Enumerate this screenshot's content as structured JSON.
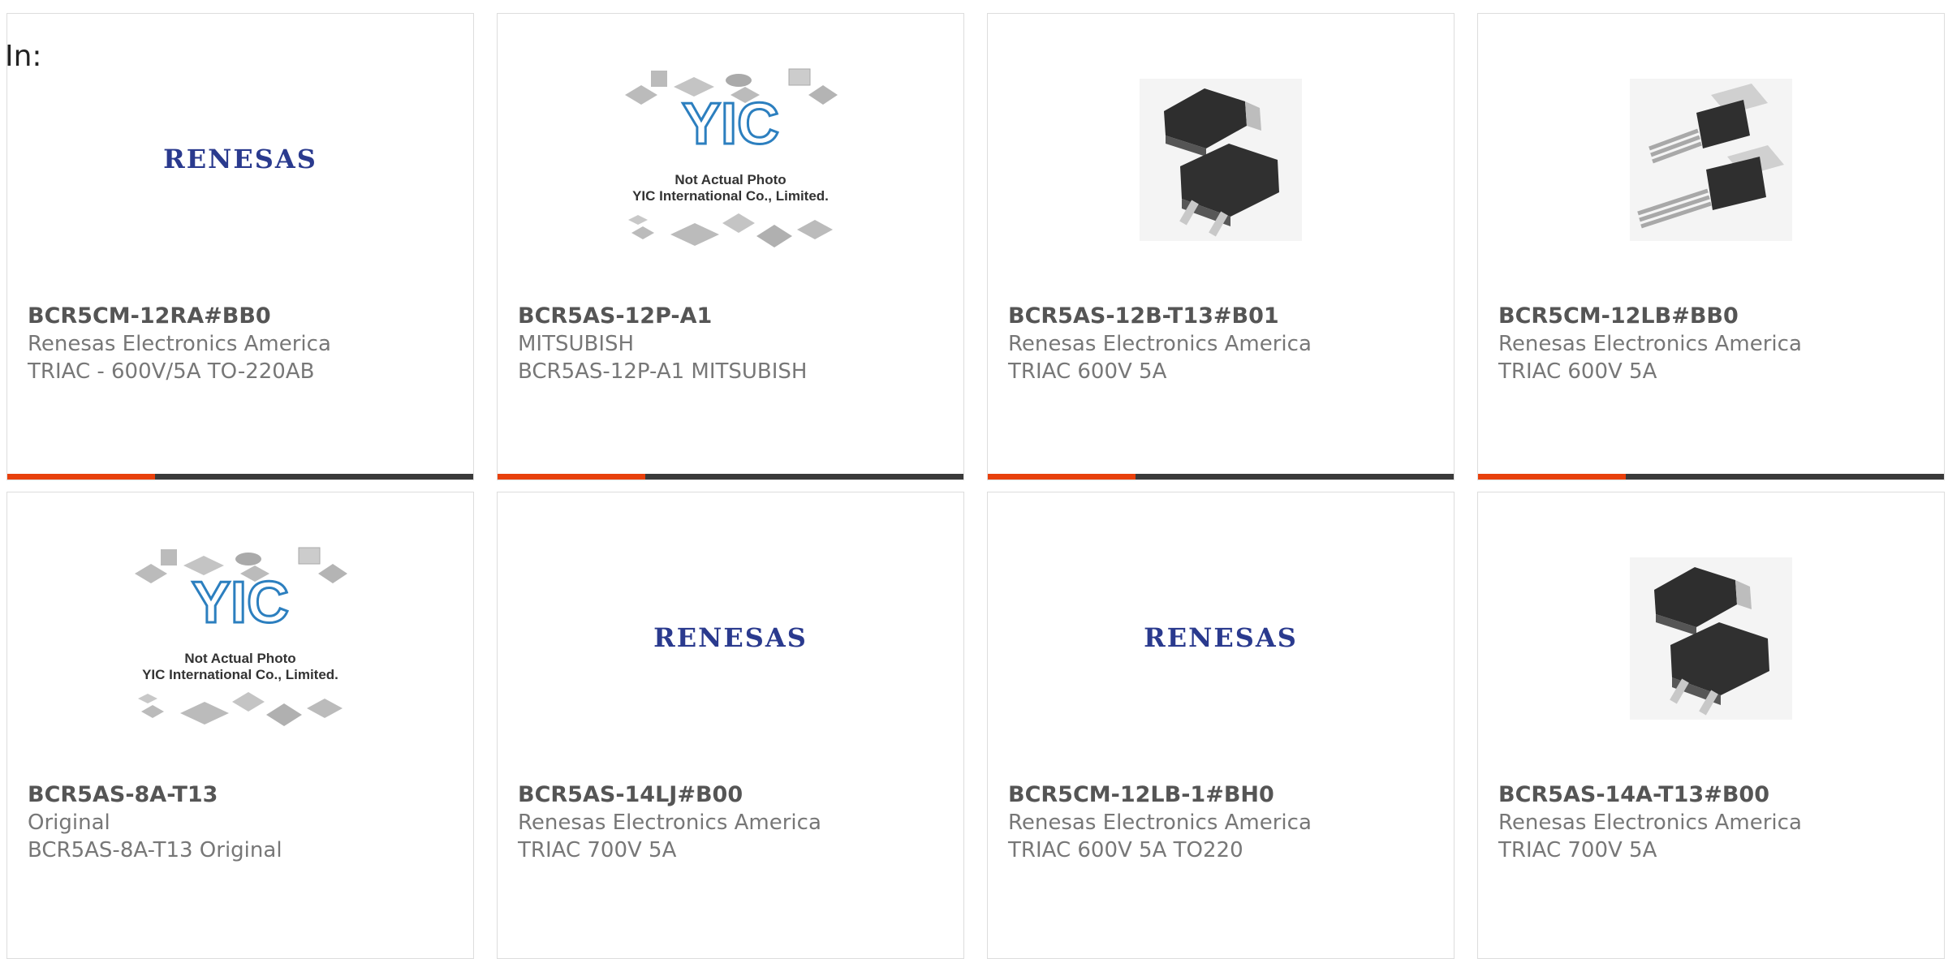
{
  "filter": {
    "label": "In:"
  },
  "logo": {
    "brand": "RENESAS",
    "color": "#2a3a8e"
  },
  "placeholder": {
    "brand": "YIC",
    "line1": "Not Actual Photo",
    "line2": "YIC International Co., Limited."
  },
  "accent_color": "#e8400c",
  "cards": [
    {
      "part": "BCR5CM-12RA#BB0",
      "maker": "Renesas Electronics America",
      "desc": "TRIAC - 600V/5A TO-220AB",
      "image": "renesas-logo"
    },
    {
      "part": "BCR5AS-12P-A1",
      "maker": "MITSUBISH",
      "desc": "BCR5AS-12P-A1 MITSUBISH",
      "image": "yic-placeholder"
    },
    {
      "part": "BCR5AS-12B-T13#B01",
      "maker": "Renesas Electronics America",
      "desc": "TRIAC 600V 5A",
      "image": "dpak-package"
    },
    {
      "part": "BCR5CM-12LB#BB0",
      "maker": "Renesas Electronics America",
      "desc": "TRIAC 600V 5A",
      "image": "to220-package"
    },
    {
      "part": "BCR5AS-8A-T13",
      "maker": "Original",
      "desc": "BCR5AS-8A-T13 Original",
      "image": "yic-placeholder"
    },
    {
      "part": "BCR5AS-14LJ#B00",
      "maker": "Renesas Electronics America",
      "desc": "TRIAC 700V 5A",
      "image": "renesas-logo"
    },
    {
      "part": "BCR5CM-12LB-1#BH0",
      "maker": "Renesas Electronics America",
      "desc": "TRIAC 600V 5A TO220",
      "image": "renesas-logo"
    },
    {
      "part": "BCR5AS-14A-T13#B00",
      "maker": "Renesas Electronics America",
      "desc": "TRIAC 700V 5A",
      "image": "dpak-package"
    }
  ]
}
